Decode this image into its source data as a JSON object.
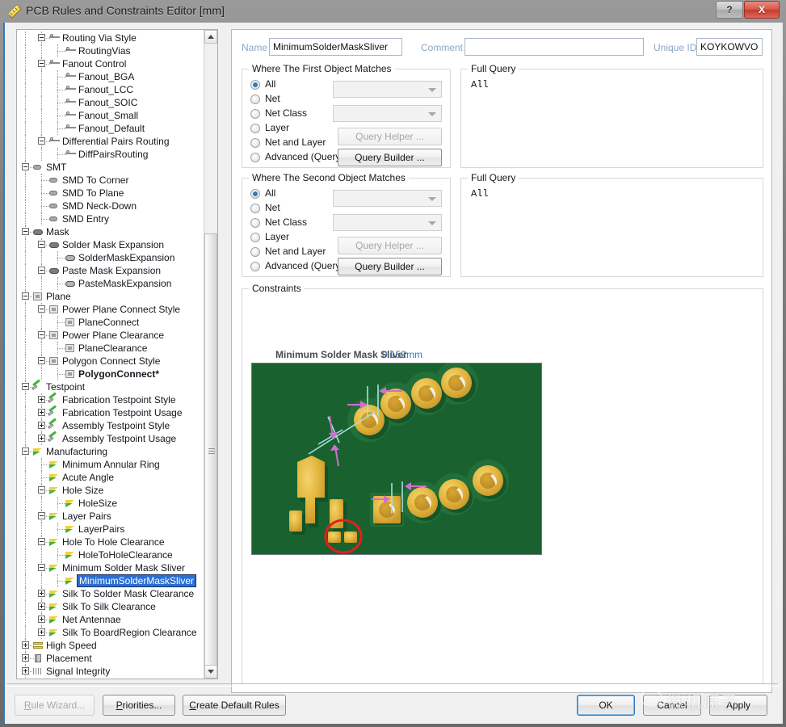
{
  "window": {
    "title": "PCB Rules and Constraints Editor [mm]",
    "icon": "ruler-icon",
    "help_label": "?",
    "close_label": "X",
    "accent_color": "#2f7bbf"
  },
  "tree": {
    "scrollbar": {
      "up_arrow": "scroll-up-icon",
      "down_arrow": "scroll-down-icon"
    },
    "items": [
      {
        "label": "Routing Via Style",
        "depth": 2,
        "icon": "routing-icon",
        "expander": "minus"
      },
      {
        "label": "RoutingVias",
        "depth": 3,
        "icon": "routing-icon",
        "expander": "none"
      },
      {
        "label": "Fanout Control",
        "depth": 2,
        "icon": "routing-icon",
        "expander": "minus"
      },
      {
        "label": "Fanout_BGA",
        "depth": 3,
        "icon": "routing-icon",
        "expander": "none"
      },
      {
        "label": "Fanout_LCC",
        "depth": 3,
        "icon": "routing-icon",
        "expander": "none"
      },
      {
        "label": "Fanout_SOIC",
        "depth": 3,
        "icon": "routing-icon",
        "expander": "none"
      },
      {
        "label": "Fanout_Small",
        "depth": 3,
        "icon": "routing-icon",
        "expander": "none"
      },
      {
        "label": "Fanout_Default",
        "depth": 3,
        "icon": "routing-icon",
        "expander": "none"
      },
      {
        "label": "Differential Pairs Routing",
        "depth": 2,
        "icon": "routing-icon",
        "expander": "minus"
      },
      {
        "label": "DiffPairsRouting",
        "depth": 3,
        "icon": "routing-icon",
        "expander": "none"
      },
      {
        "label": "SMT",
        "depth": 1,
        "icon": "smt-icon",
        "expander": "minus"
      },
      {
        "label": "SMD To Corner",
        "depth": 2,
        "icon": "smt-icon",
        "expander": "none"
      },
      {
        "label": "SMD To Plane",
        "depth": 2,
        "icon": "smt-icon",
        "expander": "none"
      },
      {
        "label": "SMD Neck-Down",
        "depth": 2,
        "icon": "smt-icon",
        "expander": "none"
      },
      {
        "label": "SMD Entry",
        "depth": 2,
        "icon": "smt-icon",
        "expander": "none"
      },
      {
        "label": "Mask",
        "depth": 1,
        "icon": "mask-icon",
        "expander": "minus"
      },
      {
        "label": "Solder Mask Expansion",
        "depth": 2,
        "icon": "mask-icon",
        "expander": "minus"
      },
      {
        "label": "SolderMaskExpansion",
        "depth": 3,
        "icon": "mask-sub-icon",
        "expander": "none"
      },
      {
        "label": "Paste Mask Expansion",
        "depth": 2,
        "icon": "mask-icon",
        "expander": "minus"
      },
      {
        "label": "PasteMaskExpansion",
        "depth": 3,
        "icon": "mask-sub-icon",
        "expander": "none"
      },
      {
        "label": "Plane",
        "depth": 1,
        "icon": "plane-icon",
        "expander": "minus"
      },
      {
        "label": "Power Plane Connect Style",
        "depth": 2,
        "icon": "plane-icon",
        "expander": "minus"
      },
      {
        "label": "PlaneConnect",
        "depth": 3,
        "icon": "plane-icon",
        "expander": "none"
      },
      {
        "label": "Power Plane Clearance",
        "depth": 2,
        "icon": "plane-icon",
        "expander": "minus"
      },
      {
        "label": "PlaneClearance",
        "depth": 3,
        "icon": "plane-icon",
        "expander": "none"
      },
      {
        "label": "Polygon Connect Style",
        "depth": 2,
        "icon": "plane-icon",
        "expander": "minus"
      },
      {
        "label": "PolygonConnect*",
        "depth": 3,
        "icon": "plane-icon",
        "expander": "none",
        "bold": true
      },
      {
        "label": "Testpoint",
        "depth": 1,
        "icon": "testpoint-icon",
        "expander": "minus"
      },
      {
        "label": "Fabrication Testpoint Style",
        "depth": 2,
        "icon": "testpoint-icon",
        "expander": "plus"
      },
      {
        "label": "Fabrication Testpoint Usage",
        "depth": 2,
        "icon": "testpoint-icon",
        "expander": "plus"
      },
      {
        "label": "Assembly Testpoint Style",
        "depth": 2,
        "icon": "testpoint-icon",
        "expander": "plus"
      },
      {
        "label": "Assembly Testpoint Usage",
        "depth": 2,
        "icon": "testpoint-icon",
        "expander": "plus"
      },
      {
        "label": "Manufacturing",
        "depth": 1,
        "icon": "manufacturing-icon",
        "expander": "minus"
      },
      {
        "label": "Minimum Annular Ring",
        "depth": 2,
        "icon": "manufacturing-icon",
        "expander": "none"
      },
      {
        "label": "Acute Angle",
        "depth": 2,
        "icon": "manufacturing-icon",
        "expander": "none"
      },
      {
        "label": "Hole Size",
        "depth": 2,
        "icon": "manufacturing-icon",
        "expander": "minus"
      },
      {
        "label": "HoleSize",
        "depth": 3,
        "icon": "manufacturing-icon",
        "expander": "none"
      },
      {
        "label": "Layer Pairs",
        "depth": 2,
        "icon": "manufacturing-icon",
        "expander": "minus"
      },
      {
        "label": "LayerPairs",
        "depth": 3,
        "icon": "manufacturing-icon",
        "expander": "none"
      },
      {
        "label": "Hole To Hole Clearance",
        "depth": 2,
        "icon": "manufacturing-icon",
        "expander": "minus"
      },
      {
        "label": "HoleToHoleClearance",
        "depth": 3,
        "icon": "manufacturing-icon",
        "expander": "none"
      },
      {
        "label": "Minimum Solder Mask Sliver",
        "depth": 2,
        "icon": "manufacturing-icon",
        "expander": "minus"
      },
      {
        "label": "MinimumSolderMaskSliver",
        "depth": 3,
        "icon": "manufacturing-icon",
        "expander": "none",
        "selected": true
      },
      {
        "label": "Silk To Solder Mask Clearance",
        "depth": 2,
        "icon": "manufacturing-icon",
        "expander": "plus"
      },
      {
        "label": "Silk To Silk Clearance",
        "depth": 2,
        "icon": "manufacturing-icon",
        "expander": "plus"
      },
      {
        "label": "Net Antennae",
        "depth": 2,
        "icon": "manufacturing-icon",
        "expander": "plus"
      },
      {
        "label": "Silk To BoardRegion Clearance",
        "depth": 2,
        "icon": "manufacturing-icon",
        "expander": "plus"
      },
      {
        "label": "High Speed",
        "depth": 1,
        "icon": "highspeed-icon",
        "expander": "plus"
      },
      {
        "label": "Placement",
        "depth": 1,
        "icon": "placement-icon",
        "expander": "plus"
      },
      {
        "label": "Signal Integrity",
        "depth": 1,
        "icon": "signalintegrity-icon",
        "expander": "plus"
      }
    ]
  },
  "form": {
    "name_label": "Name",
    "name_value": "MinimumSolderMaskSliver",
    "comment_label": "Comment",
    "comment_value": "",
    "comment_placeholder": "",
    "unique_id_label": "Unique ID",
    "unique_id_value": "KOYKOWVO"
  },
  "first_object": {
    "title": "Where The First Object Matches",
    "options": [
      {
        "label": "All",
        "selected": true
      },
      {
        "label": "Net",
        "selected": false
      },
      {
        "label": "Net Class",
        "selected": false
      },
      {
        "label": "Layer",
        "selected": false
      },
      {
        "label": "Net and Layer",
        "selected": false
      },
      {
        "label": "Advanced (Query)",
        "selected": false
      }
    ],
    "net_combo_value": "",
    "netclass_combo_value": "",
    "query_helper_label": "Query Helper ...",
    "query_helper_enabled": false,
    "query_builder_label": "Query Builder ...",
    "query_builder_enabled": true
  },
  "first_query": {
    "title": "Full Query",
    "text": "All"
  },
  "second_object": {
    "title": "Where The Second Object Matches",
    "options": [
      {
        "label": "All",
        "selected": true
      },
      {
        "label": "Net",
        "selected": false
      },
      {
        "label": "Net Class",
        "selected": false
      },
      {
        "label": "Layer",
        "selected": false
      },
      {
        "label": "Net and Layer",
        "selected": false
      },
      {
        "label": "Advanced (Query)",
        "selected": false
      }
    ],
    "net_combo_value": "",
    "netclass_combo_value": "",
    "query_helper_label": "Query Helper ...",
    "query_helper_enabled": false,
    "query_builder_label": "Query Builder ...",
    "query_builder_enabled": true
  },
  "second_query": {
    "title": "Full Query",
    "text": "All"
  },
  "constraints": {
    "title": "Constraints",
    "sliver_label": "Minimum Solder Mask Sliver",
    "sliver_value": "0.152mm",
    "value_color": "#2f7bbf",
    "image": {
      "name": "pcb-solder-mask-sliver-illustration",
      "board_color": "#19622f",
      "pad_color": "#e0b43c",
      "dimension_color": "#d06fd0",
      "leader_color": "#a8e0e0",
      "highlight_color": "#e02020"
    }
  },
  "footer": {
    "rule_wizard_label": "Rule Wizard...",
    "rule_wizard_mnemonic": "R",
    "rule_wizard_enabled": false,
    "priorities_label": "Priorities...",
    "priorities_mnemonic": "P",
    "create_default_label": "Create Default Rules",
    "create_default_mnemonic": "C",
    "ok_label": "OK",
    "cancel_label": "Cancel",
    "apply_label": "Apply"
  },
  "watermark": {
    "text": "微机原子"
  }
}
